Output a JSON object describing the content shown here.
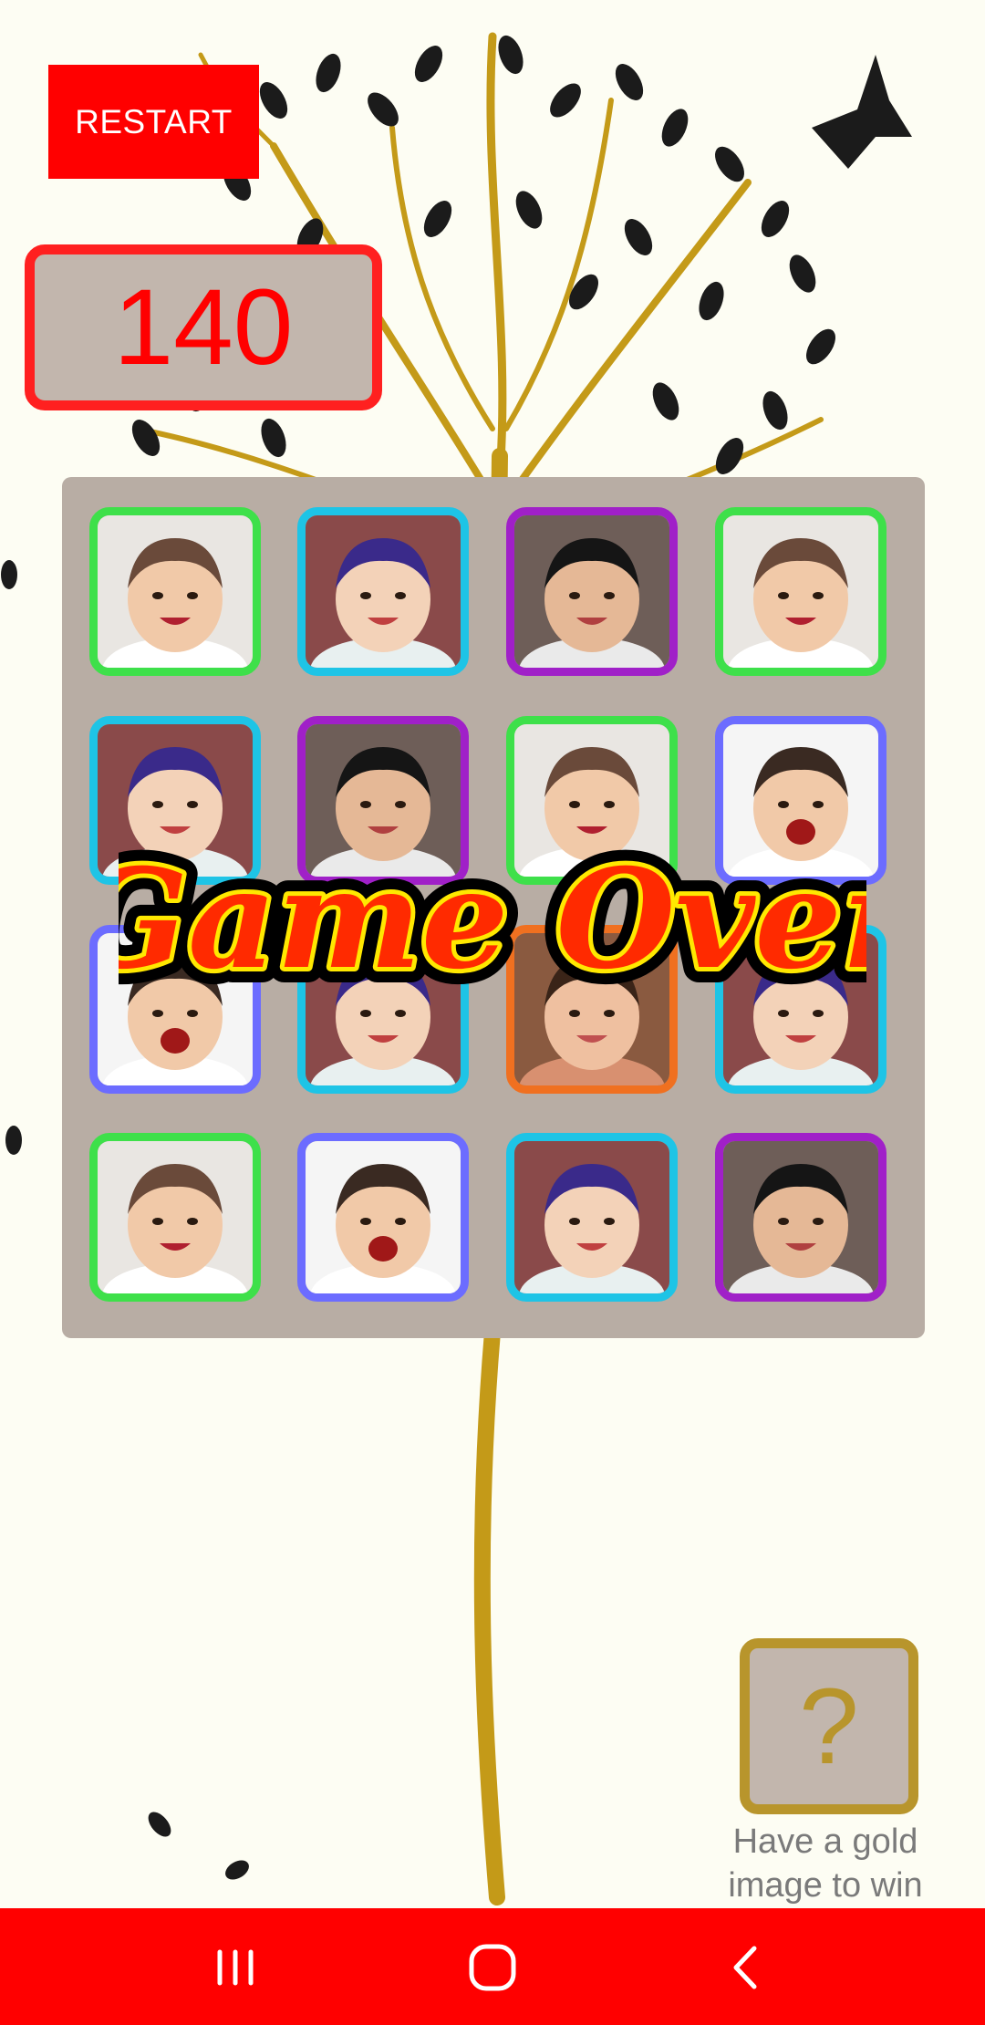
{
  "toolbar": {
    "restart_label": "RESTART"
  },
  "score": {
    "value": "140"
  },
  "board": {
    "rows": 4,
    "cols": 4,
    "tiles": [
      {
        "face": "baby-laughing",
        "frame": "green"
      },
      {
        "face": "boy-blue-hair",
        "frame": "cyan"
      },
      {
        "face": "boy-dark-hair",
        "frame": "purple"
      },
      {
        "face": "baby-laughing",
        "frame": "green"
      },
      {
        "face": "boy-blue-hair",
        "frame": "cyan"
      },
      {
        "face": "boy-dark-hair",
        "frame": "purple"
      },
      {
        "face": "baby-laughing",
        "frame": "green"
      },
      {
        "face": "toddler-open-mouth",
        "frame": "blue"
      },
      {
        "face": "toddler-open-mouth",
        "frame": "blue"
      },
      {
        "face": "boy-blue-hair",
        "frame": "cyan"
      },
      {
        "face": "woman-smiling",
        "frame": "orange"
      },
      {
        "face": "boy-blue-hair",
        "frame": "cyan"
      },
      {
        "face": "baby-laughing",
        "frame": "green"
      },
      {
        "face": "toddler-open-mouth",
        "frame": "blue"
      },
      {
        "face": "boy-blue-hair",
        "frame": "cyan"
      },
      {
        "face": "boy-dark-hair",
        "frame": "purple"
      }
    ]
  },
  "frame_colors": {
    "green": "#3ee04a",
    "cyan": "#1ec4e6",
    "purple": "#a020c8",
    "blue": "#6c6cff",
    "orange": "#f07020"
  },
  "overlay": {
    "text": "Game Over"
  },
  "hint": {
    "symbol": "?",
    "text": "Have a gold\n image to win"
  },
  "navbar": {
    "icons": [
      "recent-apps-icon",
      "home-icon",
      "back-icon"
    ],
    "color": "#ff0000"
  }
}
